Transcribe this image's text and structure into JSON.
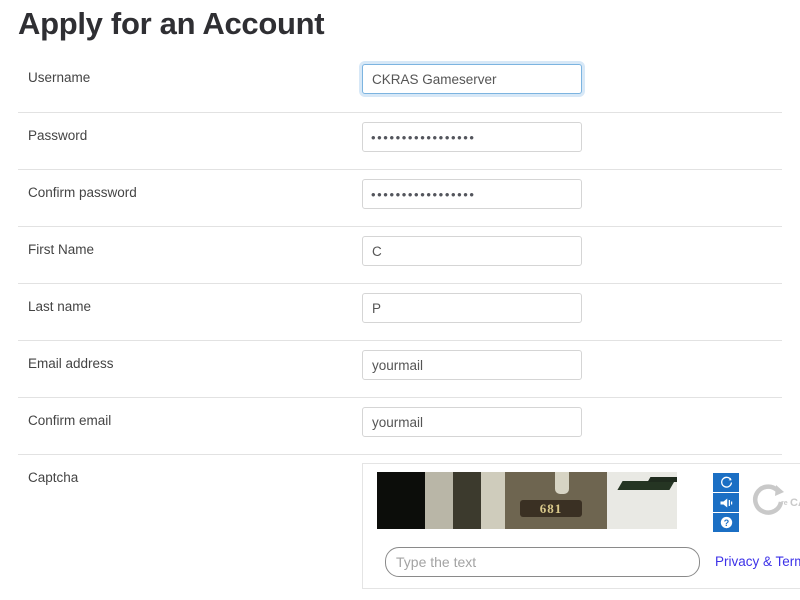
{
  "page": {
    "title": "Apply for an Account"
  },
  "form": {
    "fields": [
      {
        "label": "Username",
        "type": "text",
        "value": "CKRAS Gameserver",
        "placeholder": "",
        "focused": true
      },
      {
        "label": "Password",
        "type": "password",
        "value": "•••••••••••••••••",
        "placeholder": "",
        "focused": false
      },
      {
        "label": "Confirm password",
        "type": "password",
        "value": "•••••••••••••••••",
        "placeholder": "",
        "focused": false
      },
      {
        "label": "First Name",
        "type": "text",
        "value": "C",
        "placeholder": "",
        "focused": false
      },
      {
        "label": "Last name",
        "type": "text",
        "value": "P",
        "placeholder": "",
        "focused": false
      },
      {
        "label": "Email address",
        "type": "text",
        "value": "yourmail",
        "placeholder": "",
        "focused": false
      },
      {
        "label": "Confirm email",
        "type": "text",
        "value": "yourmail",
        "placeholder": "",
        "focused": false
      }
    ],
    "captcha": {
      "label": "Captcha",
      "image_text": "681",
      "input_value": "",
      "input_placeholder": "Type the text",
      "privacy_terms_label": "Privacy & Terms",
      "brand_label": "reCAPTCHA",
      "buttons": [
        {
          "name": "refresh-icon",
          "title": "Get a new challenge"
        },
        {
          "name": "audio-icon",
          "title": "Get an audio challenge"
        },
        {
          "name": "help-icon",
          "title": "Help"
        }
      ]
    }
  },
  "colors": {
    "title": "#2f2f33",
    "label": "#444444",
    "input_border": "#d5d5d5",
    "focus_border": "#7cb4e0",
    "divider": "#e2e2e2",
    "captcha_button": "#1b6fc4",
    "link": "#3d32e8",
    "recaptcha_grey": "#c9c9c9"
  }
}
